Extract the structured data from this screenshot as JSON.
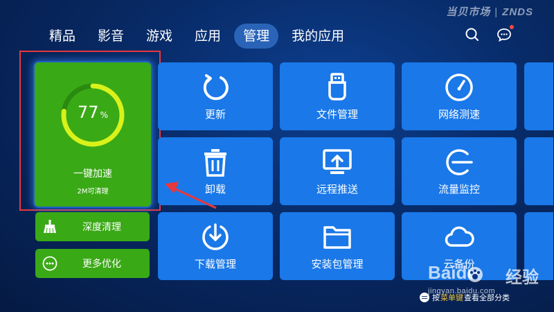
{
  "brand": {
    "name": "当贝市场",
    "sub": "ZNDS"
  },
  "nav": {
    "tabs": [
      {
        "label": "精品"
      },
      {
        "label": "影音"
      },
      {
        "label": "游戏"
      },
      {
        "label": "应用"
      },
      {
        "label": "管理",
        "active": true
      },
      {
        "label": "我的应用"
      }
    ],
    "icons": {
      "search": "search-icon",
      "message": "message-icon"
    }
  },
  "speed_card": {
    "percent": "77",
    "percent_fraction": 0.77,
    "unit": "%",
    "title": "一键加速",
    "subtitle": "2M可清理"
  },
  "side_buttons": [
    {
      "label": "深度清理",
      "icon": "broom-icon"
    },
    {
      "label": "更多优化",
      "icon": "more-icon"
    }
  ],
  "tiles": [
    {
      "label": "更新",
      "icon": "refresh-icon"
    },
    {
      "label": "文件管理",
      "icon": "usb-drive-icon"
    },
    {
      "label": "网络测速",
      "icon": "speedometer-icon"
    },
    {
      "label": "卸载",
      "icon": "trash-icon"
    },
    {
      "label": "远程推送",
      "icon": "screen-upload-icon"
    },
    {
      "label": "流量监控",
      "icon": "traffic-monitor-icon"
    },
    {
      "label": "下载管理",
      "icon": "download-icon"
    },
    {
      "label": "安装包管理",
      "icon": "folder-icon"
    },
    {
      "label": "云备份",
      "icon": "cloud-icon"
    }
  ],
  "watermark": {
    "text": "Baidu",
    "text2": "经验",
    "url": "jingyan.baidu.com"
  },
  "hint": {
    "prefix": "按",
    "key": "菜单键",
    "suffix": "查看全部分类"
  },
  "colors": {
    "accent_green": "#3aa916",
    "tile_blue": "#1a78e8",
    "highlight_red": "#e8383d",
    "active_tab": "#2a64b8"
  }
}
